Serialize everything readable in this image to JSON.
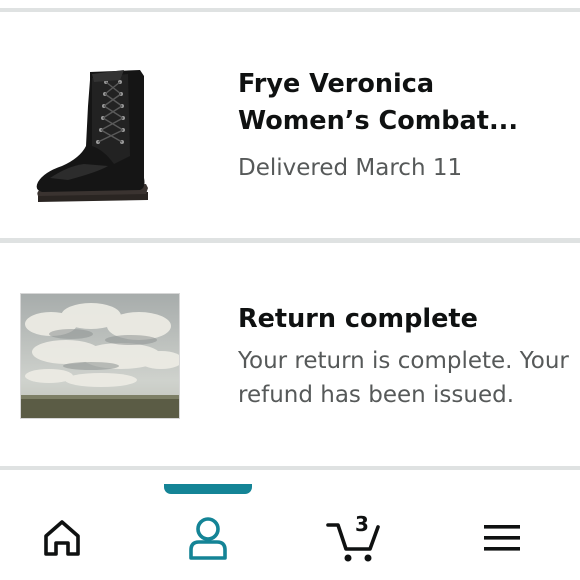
{
  "orders": [
    {
      "title": "Frye Veronica Women’s Combat...",
      "subtitle": "Delivered March 11",
      "thumbnail_icon": "boot-product-image"
    },
    {
      "title": "Return complete",
      "subtitle": "Your return is complete. Your refund has been issued.",
      "thumbnail_icon": "landscape-product-image"
    }
  ],
  "bottom_nav": {
    "items": [
      {
        "icon": "home-icon",
        "active": false
      },
      {
        "icon": "account-icon",
        "active": true
      },
      {
        "icon": "cart-icon",
        "active": false
      },
      {
        "icon": "menu-icon",
        "active": false
      }
    ],
    "cart_count": "3",
    "active_color": "#148496"
  }
}
